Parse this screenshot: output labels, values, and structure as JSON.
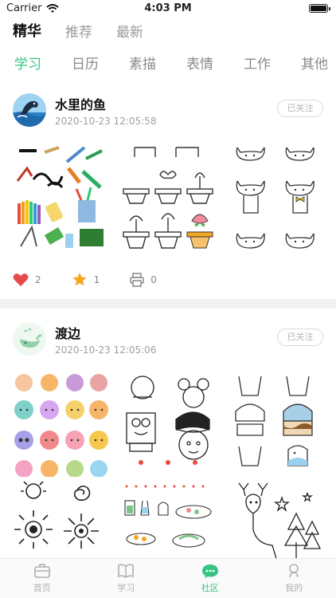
{
  "status_bar": {
    "carrier": "Carrier",
    "time": "4:03 PM"
  },
  "top_tabs": [
    {
      "label": "精华",
      "active": true
    },
    {
      "label": "推荐",
      "active": false
    },
    {
      "label": "最新",
      "active": false
    }
  ],
  "category_tabs": [
    {
      "label": "学习",
      "active": true
    },
    {
      "label": "日历",
      "active": false
    },
    {
      "label": "素描",
      "active": false
    },
    {
      "label": "表情",
      "active": false
    },
    {
      "label": "工作",
      "active": false
    },
    {
      "label": "其他",
      "active": false
    }
  ],
  "posts": [
    {
      "author": "水里的鱼",
      "time": "2020-10-23 12:05:58",
      "follow_label": "已关注",
      "likes": "2",
      "favorites": "1",
      "prints": "0",
      "images": [
        "stationery-doodles",
        "flowerpot-steps",
        "cat-face-steps"
      ]
    },
    {
      "author": "渡边",
      "time": "2020-10-23 12:05:06",
      "follow_label": "已关注",
      "images": [
        "animal-faces",
        "cartoon-characters",
        "cake-steps",
        "sun-doodles",
        "food-doodles",
        "deer-trees"
      ]
    }
  ],
  "tabbar": [
    {
      "label": "首页",
      "icon": "briefcase-icon",
      "active": false
    },
    {
      "label": "学习",
      "icon": "book-icon",
      "active": false
    },
    {
      "label": "社区",
      "icon": "chat-bubble-icon",
      "active": true
    },
    {
      "label": "我的",
      "icon": "person-icon",
      "active": false
    }
  ],
  "colors": {
    "accent": "#35c482",
    "heart": "#e84a4a",
    "star": "#f5a623"
  }
}
